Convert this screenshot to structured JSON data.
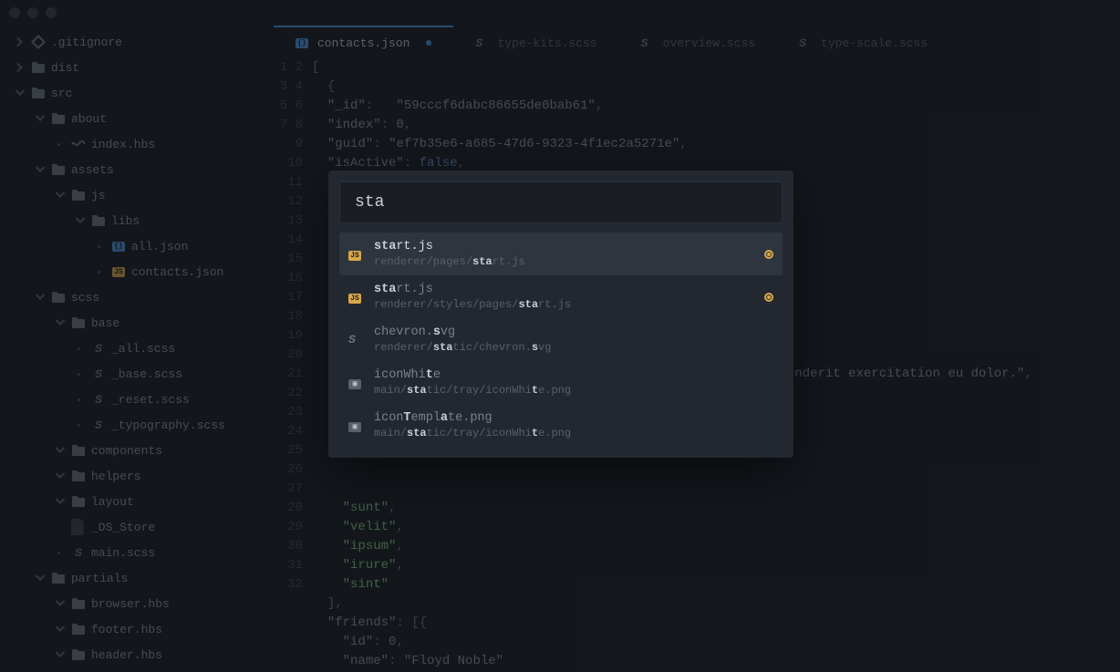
{
  "window": {
    "traffic_lights": 3
  },
  "sidebar": {
    "items": [
      {
        "name": ".gitignore",
        "depth": 0,
        "icon": "git",
        "chev": "right"
      },
      {
        "name": "dist",
        "depth": 0,
        "icon": "folder",
        "chev": "right"
      },
      {
        "name": "src",
        "depth": 0,
        "icon": "folder",
        "chev": "down"
      },
      {
        "name": "about",
        "depth": 1,
        "icon": "folder",
        "chev": "down"
      },
      {
        "name": "index.hbs",
        "depth": 2,
        "icon": "hbs",
        "dot": true
      },
      {
        "name": "assets",
        "depth": 1,
        "icon": "folder",
        "chev": "down"
      },
      {
        "name": "js",
        "depth": 2,
        "icon": "folder",
        "chev": "down"
      },
      {
        "name": "libs",
        "depth": 3,
        "icon": "folder",
        "chev": "down"
      },
      {
        "name": "all.json",
        "depth": 4,
        "icon": "json",
        "dot": true
      },
      {
        "name": "contacts.json",
        "depth": 4,
        "icon": "js",
        "dot": true
      },
      {
        "name": "scss",
        "depth": 1,
        "icon": "folder",
        "chev": "down"
      },
      {
        "name": "base",
        "depth": 2,
        "icon": "folder",
        "chev": "down"
      },
      {
        "name": "_all.scss",
        "depth": 3,
        "icon": "sass",
        "dot": true
      },
      {
        "name": "_base.scss",
        "depth": 3,
        "icon": "sass",
        "dot": true
      },
      {
        "name": "_reset.scss",
        "depth": 3,
        "icon": "sass",
        "dot": true
      },
      {
        "name": "_typography.scss",
        "depth": 3,
        "icon": "sass",
        "dot": true
      },
      {
        "name": "components",
        "depth": 2,
        "icon": "folder",
        "chev": "down"
      },
      {
        "name": "helpers",
        "depth": 2,
        "icon": "folder",
        "chev": "down"
      },
      {
        "name": "layout",
        "depth": 2,
        "icon": "folder",
        "chev": "down"
      },
      {
        "name": "_DS_Store",
        "depth": 2,
        "icon": "file",
        "dot": false
      },
      {
        "name": "main.scss",
        "depth": 2,
        "icon": "sass",
        "dot": true
      },
      {
        "name": "partials",
        "depth": 1,
        "icon": "folder",
        "chev": "down"
      },
      {
        "name": "browser.hbs",
        "depth": 2,
        "icon": "folder",
        "chev": "down"
      },
      {
        "name": "footer.hbs",
        "depth": 2,
        "icon": "folder",
        "chev": "down"
      },
      {
        "name": "header.hbs",
        "depth": 2,
        "icon": "folder",
        "chev": "down"
      }
    ]
  },
  "tabs": [
    {
      "label": "contacts.json",
      "icon": "json",
      "active": true,
      "modified": true
    },
    {
      "label": "type-kits.scss",
      "icon": "sass",
      "active": false
    },
    {
      "label": "overview.scss",
      "icon": "sass",
      "active": false
    },
    {
      "label": "type-scale.scss",
      "icon": "sass",
      "active": false
    }
  ],
  "code": {
    "lines": [
      "[",
      "  {",
      "  \"_id\":   \"59cccf6dabc86655de0bab61\",",
      "  \"index\": 0,",
      "  \"guid\": \"ef7b35e6-a685-47d6-9323-4f1ec2a5271e\",",
      "  \"isActive\": false,",
      "",
      "",
      "",
      "",
      "",
      "",
      "",
      "",
      "",
      "",
      "                                                              enderit exercitation eu dolor.\",",
      "",
      "",
      "",
      "",
      "",
      "",
      "    \"sunt\",",
      "    \"velit\",",
      "    \"ipsum\",",
      "    \"irure\",",
      "    \"sint\"",
      "  ],",
      "  \"friends\": [{",
      "    \"id\": 0,",
      "    \"name\": \"Floyd Noble\""
    ]
  },
  "palette": {
    "query": "sta",
    "results": [
      {
        "title": "start.js",
        "title_hl": [
          0,
          3
        ],
        "path": "renderer/pages/start.js",
        "path_hl": [
          15,
          18
        ],
        "icon": "js",
        "badge": true,
        "selected": true
      },
      {
        "title": "start.js",
        "title_hl": [
          0,
          3
        ],
        "path": "renderer/styles/pages/start.js",
        "path_hl": [
          22,
          25
        ],
        "icon": "js",
        "badge": true
      },
      {
        "title": "chevron.svg",
        "title_hl": [
          8,
          9
        ],
        "path": "renderer/static/chevron.svg",
        "path_hl": [
          9,
          12
        ],
        "path_hl2": [
          24,
          25
        ],
        "icon": "sass"
      },
      {
        "title": "iconWhite",
        "title_hl": [
          7,
          8
        ],
        "path": "main/static/tray/iconWhite.png",
        "path_hl": [
          5,
          8
        ],
        "path_hl2": [
          24,
          25
        ],
        "icon": "md"
      },
      {
        "title": "iconTemplate.png",
        "title_hl": [
          4,
          5
        ],
        "title_hl2": [
          9,
          10
        ],
        "path": "main/static/tray/iconWhite.png",
        "path_hl": [
          5,
          8
        ],
        "path_hl2": [
          24,
          25
        ],
        "icon": "md"
      }
    ]
  }
}
